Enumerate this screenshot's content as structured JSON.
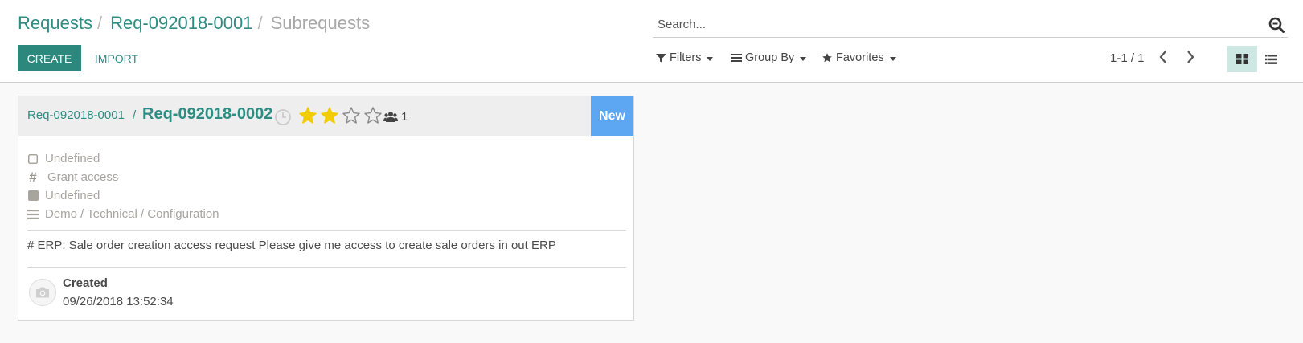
{
  "breadcrumb": [
    "Requests",
    "Req-092018-0001",
    "Subrequests"
  ],
  "buttons": {
    "create": "CREATE",
    "import": "IMPORT"
  },
  "search": {
    "placeholder": "Search..."
  },
  "search_options": {
    "filters": "Filters",
    "group_by": "Group By",
    "favorites": "Favorites"
  },
  "pager": {
    "value": "1-1 / 1"
  },
  "card": {
    "parent": "Req-092018-0001",
    "separator": "/",
    "title": "Req-092018-0002",
    "stars_filled": 2,
    "stars_total": 4,
    "followers_count": "1",
    "stage": "New",
    "fields": [
      {
        "icon": "checkbox-icon",
        "text": "Undefined"
      },
      {
        "icon": "hashtag-icon",
        "text": "Grant access"
      },
      {
        "icon": "square-icon",
        "text": "Undefined"
      },
      {
        "icon": "bars-icon",
        "text": "Demo / Technical / Configuration"
      }
    ],
    "description": "# ERP: Sale order creation access request Please give me access to create sale orders in out ERP",
    "created_label": "Created",
    "created_date": "09/26/2018 13:52:34"
  },
  "colors": {
    "primary": "#2c887d",
    "link": "#2e8c82",
    "stage": "#5ca6f2",
    "star": "#f3cc00"
  }
}
